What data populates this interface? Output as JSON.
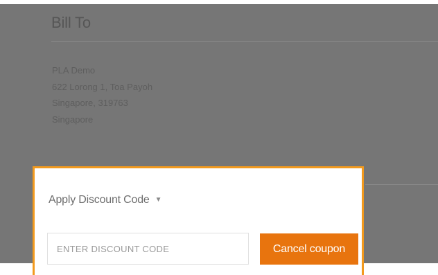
{
  "bill_to": {
    "title": "Bill To",
    "address_lines": [
      "PLA Demo",
      "622 Lorong 1, Toa Payoh",
      "Singapore, 319763",
      "Singapore"
    ]
  },
  "discount": {
    "toggle_label": "Apply Discount Code",
    "toggle_icon": "chevron-down-icon",
    "input_value": "",
    "input_placeholder": "ENTER DISCOUNT CODE",
    "cancel_label": "Cancel coupon"
  },
  "colors": {
    "highlight_border": "#f29a1e",
    "button_bg": "#e8740e",
    "overlay": "#767676"
  }
}
